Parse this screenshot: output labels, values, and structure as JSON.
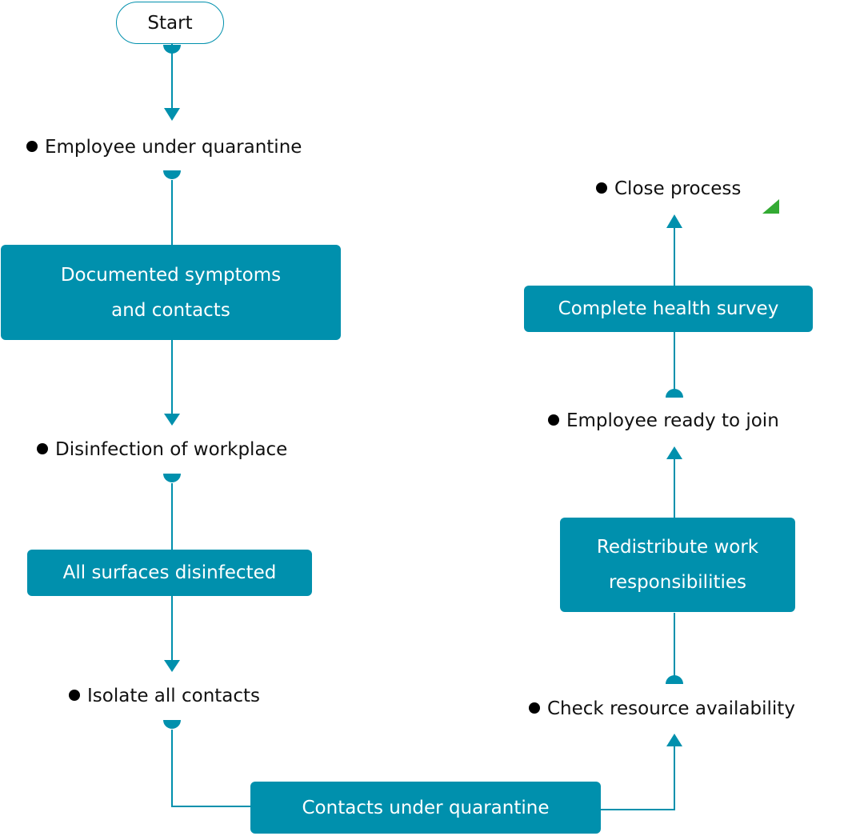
{
  "colors": {
    "accent": "#0090ad",
    "marker": "#33aa33"
  },
  "start": {
    "label": "Start"
  },
  "events": [
    {
      "label": "Employee under quarantine"
    },
    {
      "label": "Disinfection of workplace"
    },
    {
      "label": "Isolate all contacts"
    },
    {
      "label": "Check resource availability"
    },
    {
      "label": "Employee ready to join"
    },
    {
      "label": "Close process"
    }
  ],
  "tasks": [
    {
      "label": "Documented symptoms and contacts"
    },
    {
      "label": "All surfaces disinfected"
    },
    {
      "label": "Contacts under quarantine"
    },
    {
      "label": "Redistribute work responsibilities"
    },
    {
      "label": "Complete health survey"
    }
  ]
}
